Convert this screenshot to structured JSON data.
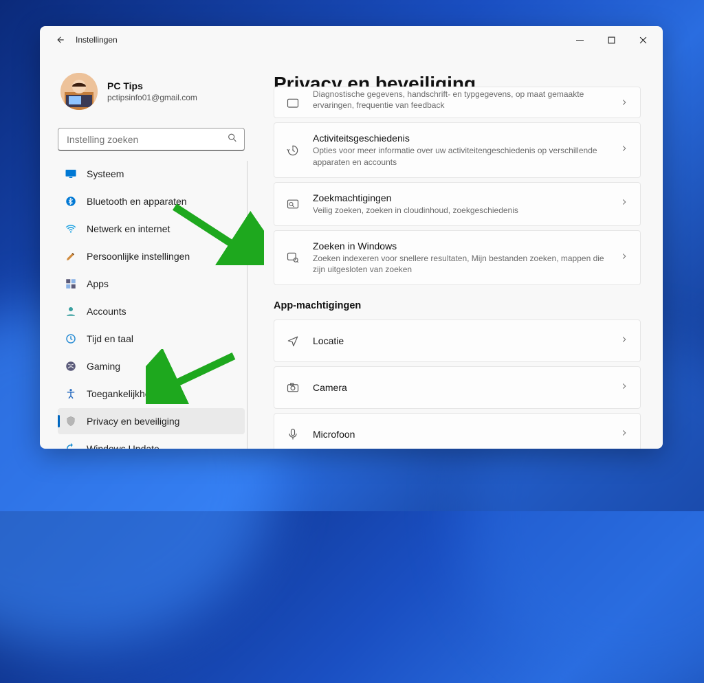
{
  "window": {
    "title": "Instellingen"
  },
  "profile": {
    "name": "PC Tips",
    "email": "pctipsinfo01@gmail.com"
  },
  "search": {
    "placeholder": "Instelling zoeken"
  },
  "nav": [
    {
      "key": "system",
      "label": "Systeem"
    },
    {
      "key": "bluetooth",
      "label": "Bluetooth en apparaten"
    },
    {
      "key": "network",
      "label": "Netwerk en internet"
    },
    {
      "key": "personalization",
      "label": "Persoonlijke instellingen"
    },
    {
      "key": "apps",
      "label": "Apps"
    },
    {
      "key": "accounts",
      "label": "Accounts"
    },
    {
      "key": "time",
      "label": "Tijd en taal"
    },
    {
      "key": "gaming",
      "label": "Gaming"
    },
    {
      "key": "accessibility",
      "label": "Toegankelijkheid"
    },
    {
      "key": "privacy",
      "label": "Privacy en beveiliging"
    },
    {
      "key": "update",
      "label": "Windows Update"
    }
  ],
  "page": {
    "title": "Privacy en beveiliging",
    "cards": [
      {
        "key": "diagnostics",
        "title": "",
        "sub": "Diagnostische gegevens, handschrift- en typgegevens, op maat gemaakte ervaringen, frequentie van feedback",
        "cut": true
      },
      {
        "key": "activity",
        "title": "Activiteitsgeschiedenis",
        "sub": "Opties voor meer informatie over uw activiteitengeschiedenis op verschillende apparaten en accounts"
      },
      {
        "key": "searchperm",
        "title": "Zoekmachtigingen",
        "sub": "Veilig zoeken, zoeken in cloudinhoud, zoekgeschiedenis"
      },
      {
        "key": "searchwin",
        "title": "Zoeken in Windows",
        "sub": "Zoeken indexeren voor snellere resultaten, Mijn bestanden zoeken, mappen die zijn uitgesloten van zoeken"
      }
    ],
    "section": "App-machtigingen",
    "perm_cards": [
      {
        "key": "location",
        "title": "Locatie"
      },
      {
        "key": "camera",
        "title": "Camera"
      },
      {
        "key": "microphone",
        "title": "Microfoon"
      }
    ]
  }
}
